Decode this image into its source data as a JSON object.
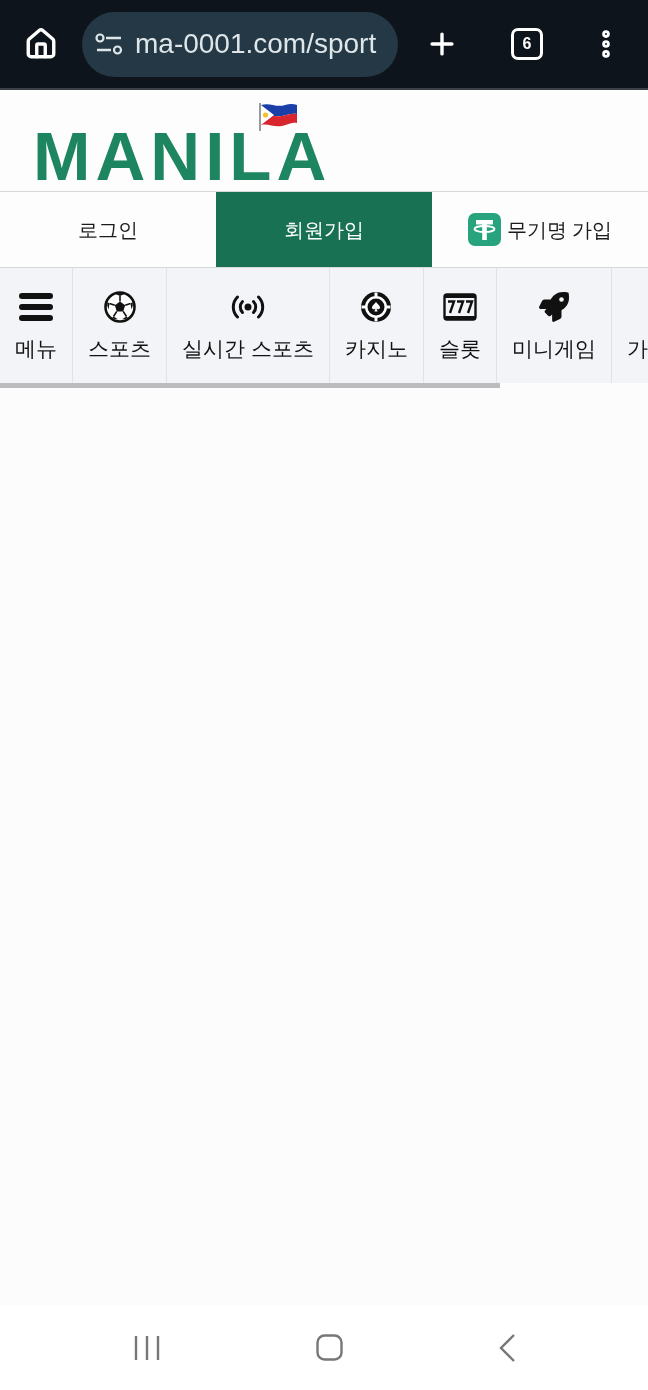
{
  "browser": {
    "url": "ma-0001.com/sport",
    "tab_count": "6"
  },
  "logo": {
    "text": "MANILA"
  },
  "auth_tabs": [
    {
      "label": "로그인",
      "selected": false,
      "kind": "plain"
    },
    {
      "label": "회원가입",
      "selected": true,
      "kind": "plain"
    },
    {
      "label": "무기명 가입",
      "selected": false,
      "kind": "coin"
    }
  ],
  "nav": {
    "items": [
      {
        "label": "메뉴",
        "kind": "menu"
      },
      {
        "label": "스포츠",
        "kind": "soccer"
      },
      {
        "label": "실시간 스포츠",
        "kind": "live"
      },
      {
        "label": "카지노",
        "kind": "casino"
      },
      {
        "label": "슬롯",
        "kind": "slot"
      },
      {
        "label": "미니게임",
        "kind": "rocket"
      },
      {
        "label": "가",
        "kind": "cut"
      }
    ]
  }
}
